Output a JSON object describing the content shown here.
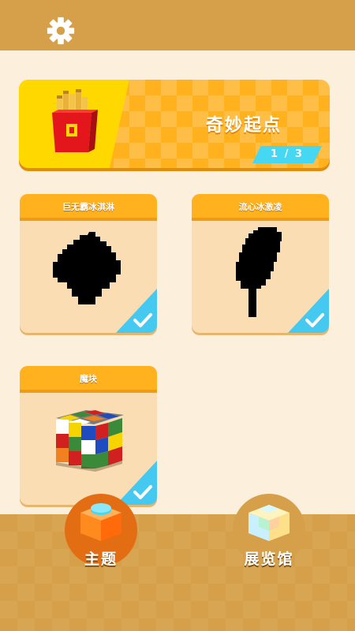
{
  "topbar": {
    "settings_icon": "gear-icon"
  },
  "theme": {
    "title": "奇妙起点",
    "page_indicator": "1 / 3",
    "thumbnail_icon": "french-fries-icon"
  },
  "items": [
    {
      "name": "巨无霸冰淇淋",
      "completed": true,
      "art": "ice-cream-silhouette"
    },
    {
      "name": "流心冰激凌",
      "completed": true,
      "art": "popsicle-silhouette"
    },
    {
      "name": "魔块",
      "completed": true,
      "art": "voxel-rubik-cube"
    }
  ],
  "bottom_nav": {
    "theme_label": "主题",
    "gallery_label": "展览馆"
  },
  "colors": {
    "header": "#d6a04a",
    "background": "#fcefdc",
    "accent_orange": "#ffb11e",
    "accent_yellow": "#ffd800",
    "check_blue": "#45c9f0"
  }
}
